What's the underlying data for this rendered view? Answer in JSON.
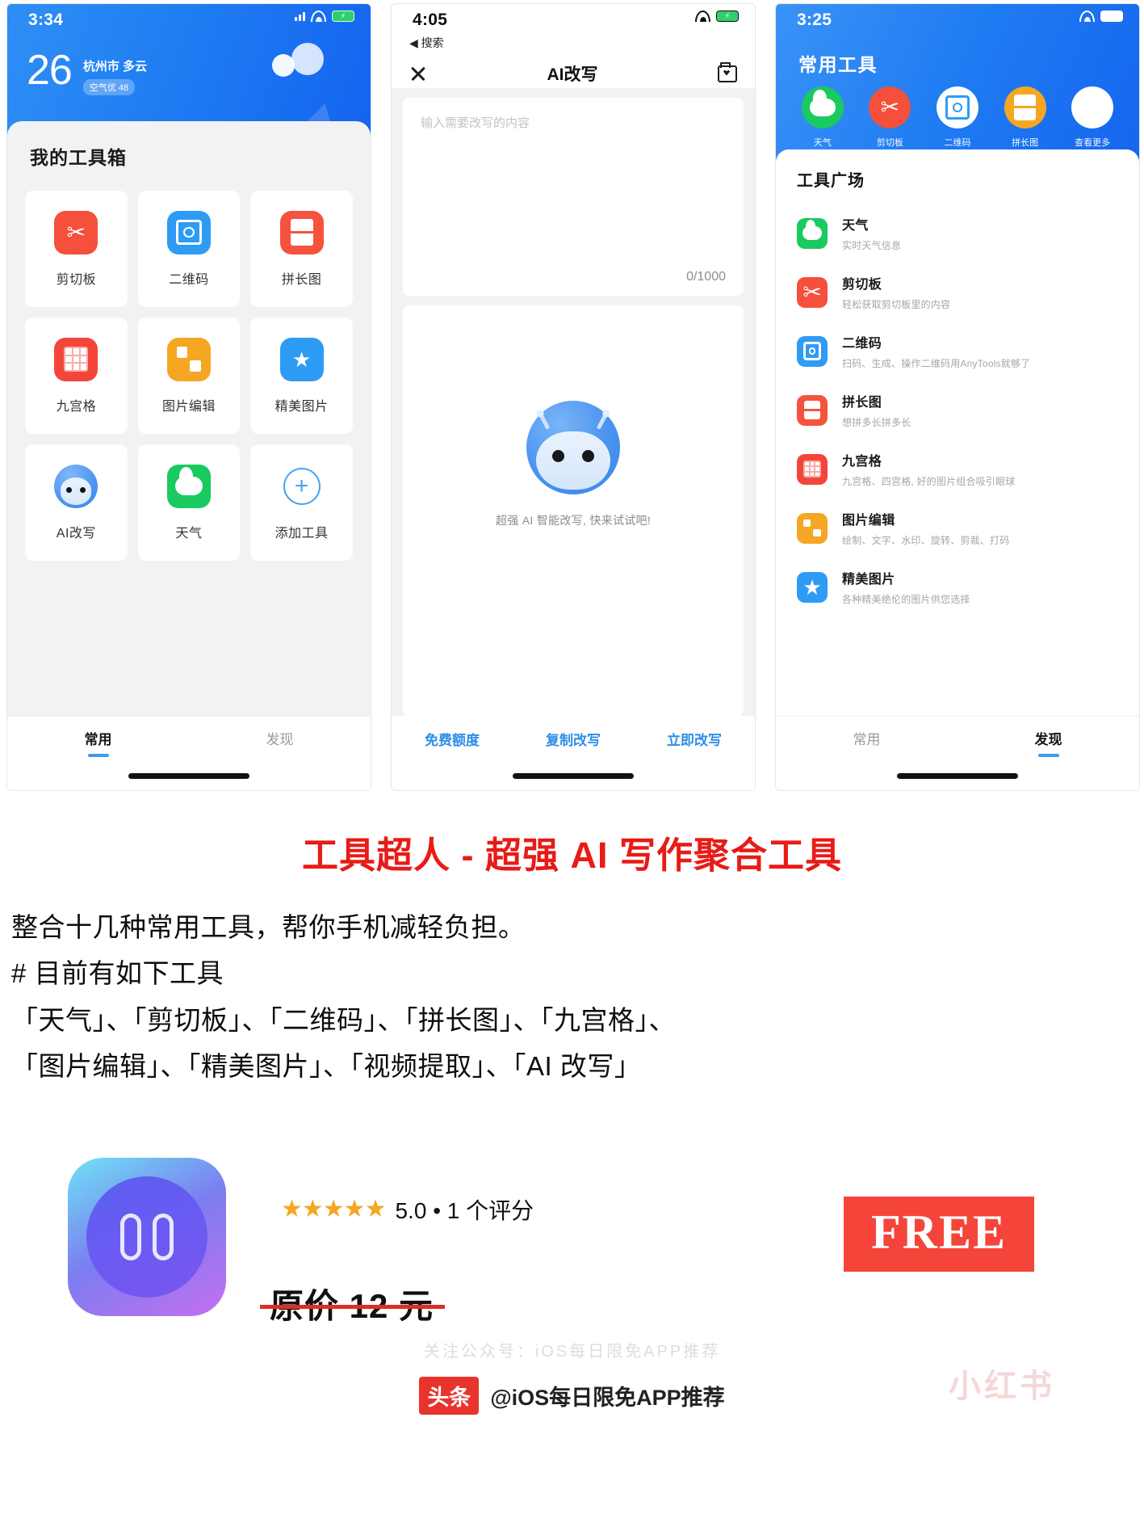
{
  "phone1": {
    "status": {
      "time": "3:34"
    },
    "weather": {
      "temp": "26",
      "city": "杭州市 多云",
      "aqi": "空气优 48"
    },
    "section_title": "我的工具箱",
    "tools": [
      {
        "label": "剪切板",
        "icon": "scissors-icon",
        "color": "#f4503c"
      },
      {
        "label": "二维码",
        "icon": "qrcode-icon",
        "color": "#2e9bf5"
      },
      {
        "label": "拼长图",
        "icon": "long-image-icon",
        "color": "#f4533e"
      },
      {
        "label": "九宫格",
        "icon": "grid-nine-icon",
        "color": "#f4453a"
      },
      {
        "label": "图片编辑",
        "icon": "image-edit-icon",
        "color": "#f5a623"
      },
      {
        "label": "精美图片",
        "icon": "star-image-icon",
        "color": "#2e9bf5"
      },
      {
        "label": "AI改写",
        "icon": "robot-icon",
        "color": "#4d95f1"
      },
      {
        "label": "天气",
        "icon": "weather-icon",
        "color": "#18ca60"
      },
      {
        "label": "添加工具",
        "icon": "plus-circle-icon",
        "color": "#4aa3ef"
      }
    ],
    "tabs": [
      {
        "label": "常用",
        "active": true
      },
      {
        "label": "发现",
        "active": false
      }
    ]
  },
  "phone2": {
    "status": {
      "time": "4:05"
    },
    "back_label": "搜索",
    "nav_title": "AI改写",
    "close_icon": "close-icon",
    "folder_icon": "folder-favorite-icon",
    "input_placeholder": "输入需要改写的内容",
    "char_count": "0/1000",
    "empty_hint": "超强 AI 智能改写, 快来试试吧!",
    "actions": [
      {
        "label": "免费额度"
      },
      {
        "label": "复制改写"
      },
      {
        "label": "立即改写"
      }
    ]
  },
  "phone3": {
    "status": {
      "time": "3:25"
    },
    "hero_title": "常用工具",
    "quick": [
      {
        "label": "天气",
        "icon": "weather-icon",
        "color": "#18ca60"
      },
      {
        "label": "剪切板",
        "icon": "scissors-icon",
        "color": "#f4503c"
      },
      {
        "label": "二维码",
        "icon": "qrcode-icon",
        "color": "#ffffff"
      },
      {
        "label": "拼长图",
        "icon": "long-image-icon",
        "color": "#f5a623"
      },
      {
        "label": "查看更多",
        "icon": "more-dots-icon",
        "color": "#ffffff"
      }
    ],
    "list_title": "工具广场",
    "list": [
      {
        "name": "天气",
        "desc": "实时天气信息",
        "icon": "weather-icon",
        "color": "#18ca60"
      },
      {
        "name": "剪切板",
        "desc": "轻松获取剪切板里的内容",
        "icon": "scissors-icon",
        "color": "#f4503c"
      },
      {
        "name": "二维码",
        "desc": "扫码、生成、操作二维码用AnyTools就够了",
        "icon": "qrcode-icon",
        "color": "#2e9bf5"
      },
      {
        "name": "拼长图",
        "desc": "想拼多长拼多长",
        "icon": "long-image-icon",
        "color": "#f4533e"
      },
      {
        "name": "九宫格",
        "desc": "九宫格、四宫格, 好的图片组合吸引眼球",
        "icon": "grid-nine-icon",
        "color": "#f4453a"
      },
      {
        "name": "图片编辑",
        "desc": "绘制、文字、水印、旋转、剪裁、打码",
        "icon": "image-edit-icon",
        "color": "#f5a623"
      },
      {
        "name": "精美图片",
        "desc": "各种精美绝伦的图片供您选择",
        "icon": "star-image-icon",
        "color": "#2e9bf5"
      }
    ],
    "tabs": [
      {
        "label": "常用",
        "active": false
      },
      {
        "label": "发现",
        "active": true
      }
    ]
  },
  "promo": {
    "headline": "工具超人 - 超强 AI 写作聚合工具",
    "line1": "整合十几种常用工具，帮你手机减轻负担。",
    "line2": "# 目前有如下工具",
    "line3": "「天气」、「剪切板」、「二维码」、「拼长图」、「九宫格」、",
    "line4": "「图片编辑」、「精美图片」、「视频提取」、「AI 改写」"
  },
  "footer": {
    "stars": "★★★★★",
    "rating_text": "5.0 • 1 个评分",
    "original_price": "原价 12 元",
    "free_badge": "FREE",
    "watermark": "小红书",
    "faint_text": "关注公众号：iOS每日限免APP推荐",
    "account_logo": "头条",
    "account_name": "@iOS每日限免APP推荐"
  },
  "colors": {
    "brand_blue": "#1f7df2",
    "accent_red": "#e81b17",
    "free_red": "#f5453b",
    "tab_active": "#3d9bf0"
  }
}
